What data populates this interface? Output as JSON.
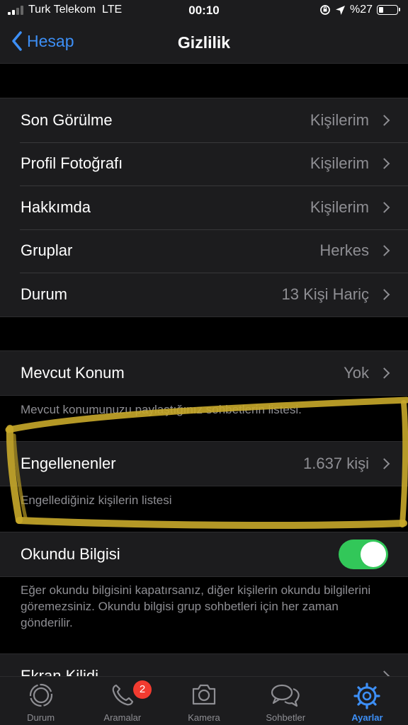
{
  "status_bar": {
    "carrier": "Turk Telekom",
    "network": "LTE",
    "time": "00:10",
    "battery": "%27",
    "battery_level": 0.27
  },
  "nav": {
    "back_label": "Hesap",
    "title": "Gizlilik"
  },
  "privacy_rows": [
    {
      "label": "Son Görülme",
      "value": "Kişilerim"
    },
    {
      "label": "Profil Fotoğrafı",
      "value": "Kişilerim"
    },
    {
      "label": "Hakkımda",
      "value": "Kişilerim"
    },
    {
      "label": "Gruplar",
      "value": "Herkes"
    },
    {
      "label": "Durum",
      "value": "13 Kişi Hariç"
    }
  ],
  "live_location": {
    "label": "Mevcut Konum",
    "value": "Yok",
    "footnote": "Mevcut konumunuzu paylaştığınız sohbetlerin listesi."
  },
  "blocked": {
    "label": "Engellenenler",
    "value": "1.637 kişi",
    "footnote": "Engellediğiniz kişilerin listesi"
  },
  "read_receipts": {
    "label": "Okundu Bilgisi",
    "enabled": true,
    "footnote": "Eğer okundu bilgisini kapatırsanız, diğer kişilerin okundu bilgilerini göremezsiniz. Okundu bilgisi grup sohbetleri için her zaman gönderilir."
  },
  "screen_lock": {
    "label": "Ekran Kilidi"
  },
  "tabs": [
    {
      "label": "Durum",
      "icon": "status-icon"
    },
    {
      "label": "Aramalar",
      "icon": "phone-icon",
      "badge": "2"
    },
    {
      "label": "Kamera",
      "icon": "camera-icon"
    },
    {
      "label": "Sohbetler",
      "icon": "chats-icon"
    },
    {
      "label": "Ayarlar",
      "icon": "settings-icon",
      "active": true
    }
  ],
  "colors": {
    "accent": "#3d8ff6",
    "toggle_on": "#32c759",
    "badge": "#f23b30",
    "highlight": "#c8a92a"
  }
}
